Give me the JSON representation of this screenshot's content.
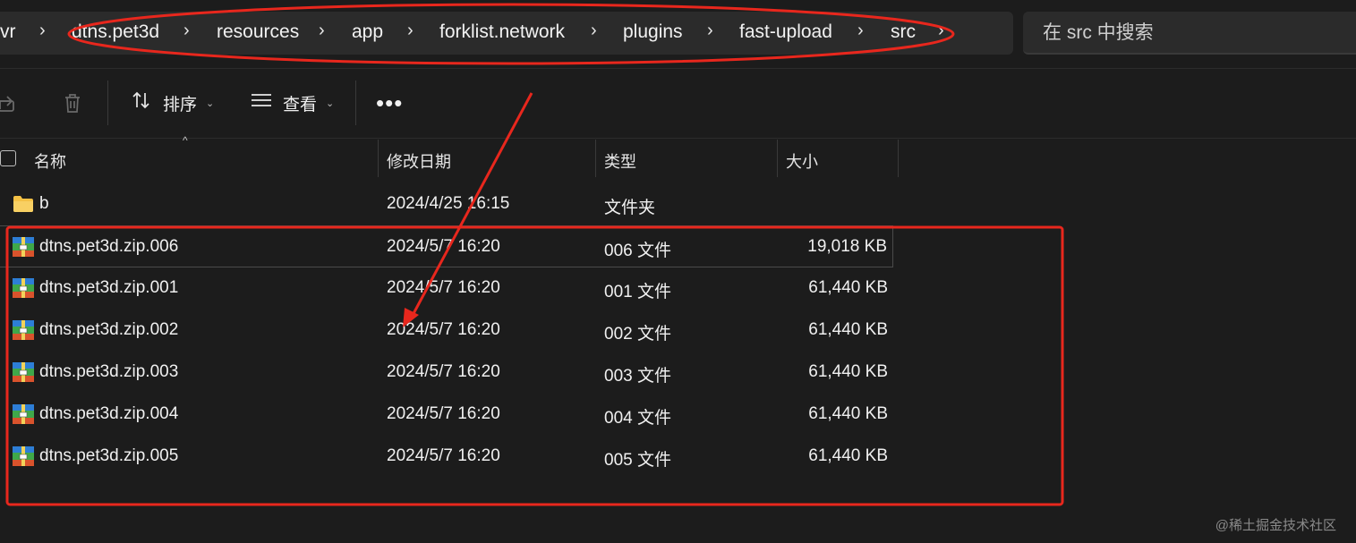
{
  "breadcrumb": {
    "items": [
      "vr",
      "dtns.pet3d",
      "resources",
      "app",
      "forklist.network",
      "plugins",
      "fast-upload",
      "src"
    ]
  },
  "search": {
    "placeholder": "在 src 中搜索"
  },
  "toolbar": {
    "sort_label": "排序",
    "view_label": "查看",
    "more_label": "•••"
  },
  "columns": {
    "name": "名称",
    "date": "修改日期",
    "type": "类型",
    "size": "大小"
  },
  "files": [
    {
      "name": "b",
      "date": "2024/4/25 16:15",
      "type": "文件夹",
      "size": "",
      "icon": "folder-icon"
    },
    {
      "name": "dtns.pet3d.zip.006",
      "date": "2024/5/7 16:20",
      "type": "006 文件",
      "size": "19,018 KB",
      "icon": "archive-icon",
      "selected": true
    },
    {
      "name": "dtns.pet3d.zip.001",
      "date": "2024/5/7 16:20",
      "type": "001 文件",
      "size": "61,440 KB",
      "icon": "archive-icon"
    },
    {
      "name": "dtns.pet3d.zip.002",
      "date": "2024/5/7 16:20",
      "type": "002 文件",
      "size": "61,440 KB",
      "icon": "archive-icon"
    },
    {
      "name": "dtns.pet3d.zip.003",
      "date": "2024/5/7 16:20",
      "type": "003 文件",
      "size": "61,440 KB",
      "icon": "archive-icon"
    },
    {
      "name": "dtns.pet3d.zip.004",
      "date": "2024/5/7 16:20",
      "type": "004 文件",
      "size": "61,440 KB",
      "icon": "archive-icon"
    },
    {
      "name": "dtns.pet3d.zip.005",
      "date": "2024/5/7 16:20",
      "type": "005 文件",
      "size": "61,440 KB",
      "icon": "archive-icon"
    }
  ],
  "watermark": "@稀土掘金技术社区",
  "colors": {
    "annotation": "#e8271d",
    "folder": "#f4c145",
    "background": "#1c1c1c"
  }
}
